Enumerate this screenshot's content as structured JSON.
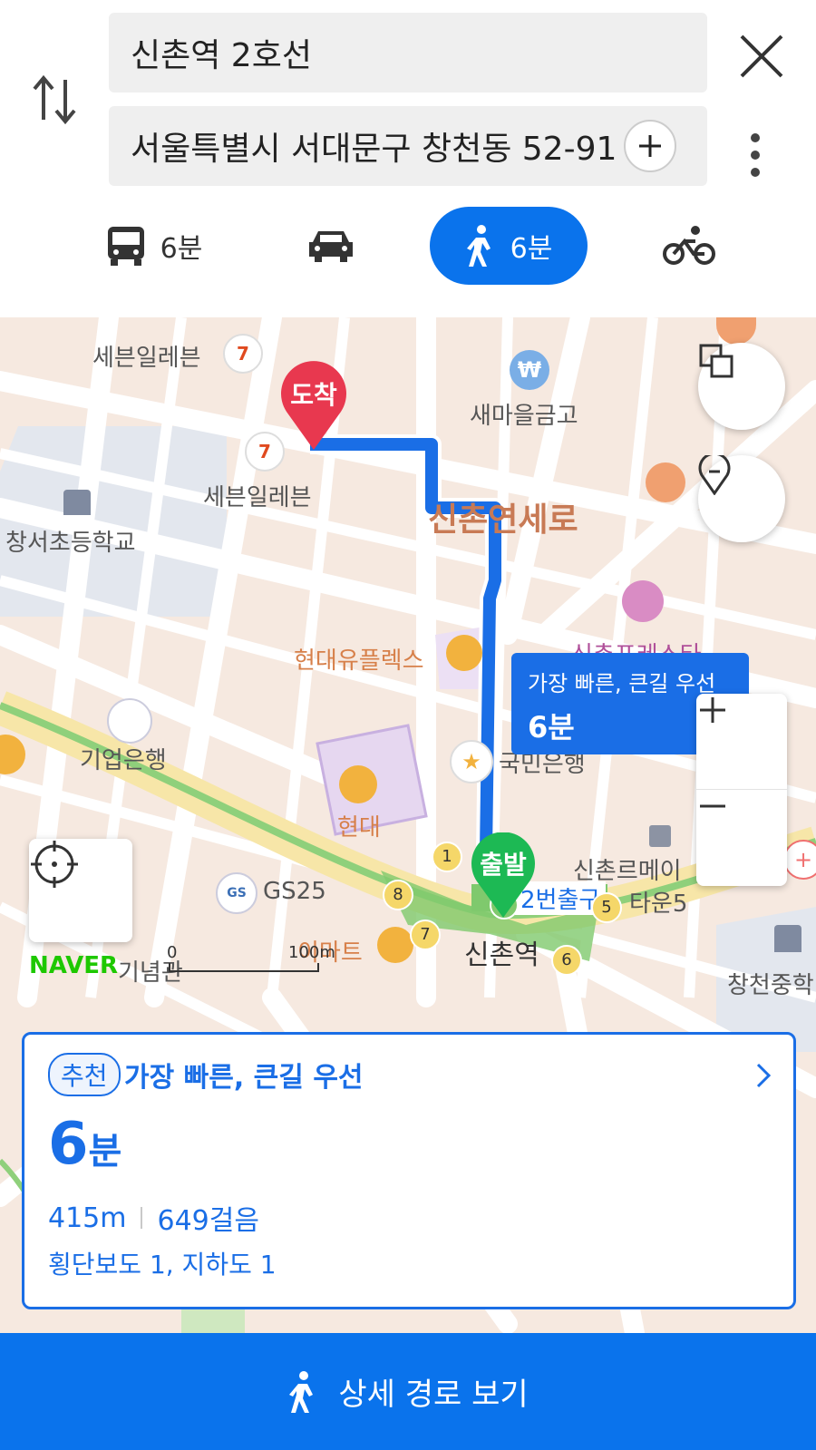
{
  "search": {
    "origin": "신촌역 2호선",
    "destination": "서울특별시 서대문구 창천동 52-91"
  },
  "modes": [
    {
      "name": "bus",
      "time": "6분",
      "active": false
    },
    {
      "name": "car",
      "time": "",
      "active": false
    },
    {
      "name": "walk",
      "time": "6분",
      "active": true
    },
    {
      "name": "bike",
      "time": "",
      "active": false
    }
  ],
  "map": {
    "pois": {
      "seven1": "세븐일레븐",
      "seven2": "세븐일레븐",
      "saemaul": "새마을금고",
      "school": "창서초등학교",
      "street": "신촌연세로",
      "uplex": "현대유플렉스",
      "forest": "신촌포레스타",
      "ibk": "기업은행",
      "kookmin": "국민은행",
      "hyundai": "현대",
      "gs25": "GS25",
      "emart": "이마트",
      "station": "신촌역",
      "exit": "2번출구",
      "meitown1": "신촌르메이",
      "meitown2": "타운5",
      "hall": "기념관",
      "changcheon": "창천중학"
    },
    "pins": {
      "arrive": "도착",
      "depart": "출발"
    },
    "route_bubble": {
      "label": "가장 빠른, 큰길 우선",
      "time": "6분"
    },
    "brand": "NAVER",
    "scale": {
      "zero": "0",
      "distance": "100m"
    },
    "exit_numbers": [
      "1",
      "2",
      "5",
      "6",
      "7",
      "8"
    ]
  },
  "route": {
    "badge": "추천",
    "title": "가장 빠른, 큰길 우선",
    "time_num": "6",
    "time_unit": "분",
    "distance": "415m",
    "steps": "649걸음",
    "info": "횡단보도 1, 지하도 1"
  },
  "bottom": {
    "label": "상세 경로 보기"
  }
}
